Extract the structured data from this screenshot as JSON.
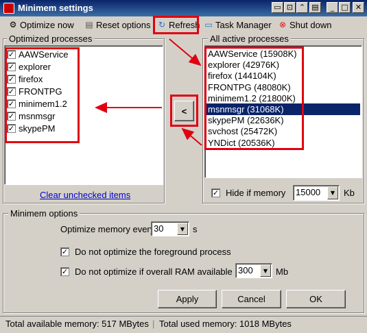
{
  "window": {
    "title": "Minimem settings"
  },
  "toolbar": {
    "optimize_now": "Optimize now",
    "reset_options": "Reset options",
    "refresh": "Refresh",
    "task_manager": "Task Manager",
    "shut_down": "Shut down"
  },
  "optimized": {
    "group_label": "Optimized processes",
    "items": [
      {
        "label": "AAWService",
        "checked": true
      },
      {
        "label": "explorer",
        "checked": true
      },
      {
        "label": "firefox",
        "checked": true
      },
      {
        "label": "FRONTPG",
        "checked": true
      },
      {
        "label": "minimem1.2",
        "checked": true
      },
      {
        "label": "msnmsgr",
        "checked": true
      },
      {
        "label": "skypePM",
        "checked": true
      }
    ],
    "clear_link": "Clear unchecked items"
  },
  "move_button": "<",
  "active": {
    "group_label": "All active processes",
    "items": [
      {
        "label": "AAWService (15908K)",
        "selected": false
      },
      {
        "label": "explorer (42976K)",
        "selected": false
      },
      {
        "label": "firefox (144104K)",
        "selected": false
      },
      {
        "label": "FRONTPG (48080K)",
        "selected": false
      },
      {
        "label": "minimem1.2 (21800K)",
        "selected": false
      },
      {
        "label": "msnmsgr (31068K)",
        "selected": true
      },
      {
        "label": "skypePM (22636K)",
        "selected": false
      },
      {
        "label": "svchost (25472K)",
        "selected": false
      },
      {
        "label": "YNDict (20536K)",
        "selected": false
      }
    ],
    "hide_label": "Hide if memory",
    "hide_value": "15000",
    "hide_unit": "Kb"
  },
  "options": {
    "group_label": "Minimem options",
    "every_label": "Optimize memory every",
    "every_value": "30",
    "every_unit": "s",
    "foreground_label": "Do not optimize the foreground process",
    "ram_label": "Do not optimize if overall RAM available >",
    "ram_value": "300",
    "ram_unit": "Mb"
  },
  "buttons": {
    "apply": "Apply",
    "cancel": "Cancel",
    "ok": "OK"
  },
  "status": {
    "available": "Total available memory: 517 MBytes",
    "used": "Total used memory: 1018 MBytes"
  },
  "colors": {
    "highlight": "#e00010",
    "selection": "#0a246a"
  }
}
